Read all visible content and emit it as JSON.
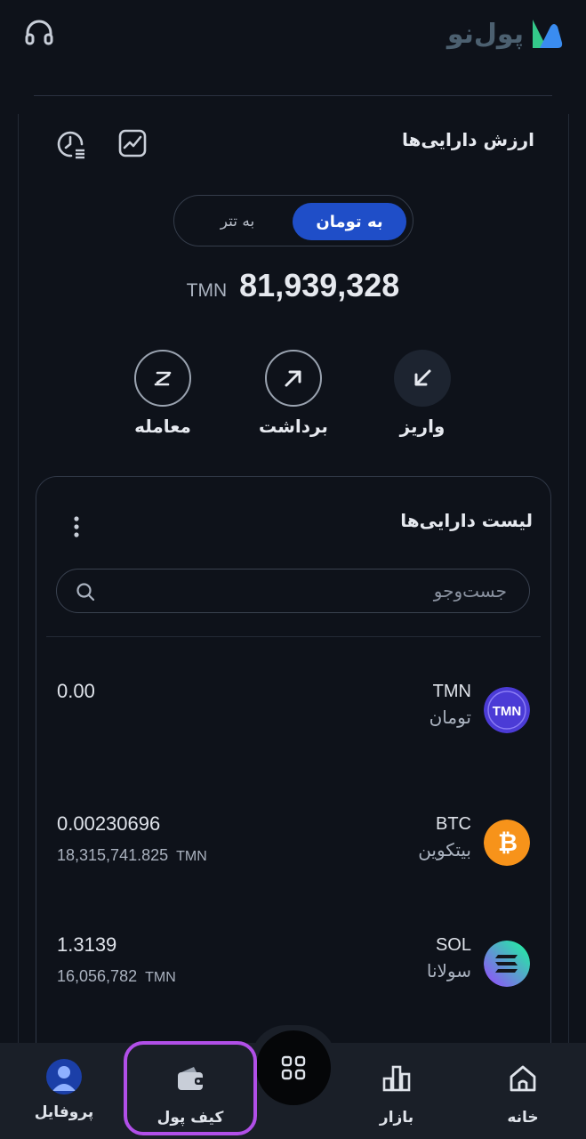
{
  "header": {
    "logo_text": "پول‌نو"
  },
  "overview": {
    "title": "ارزش دارایی‌ها",
    "toggle_toman": "به تومان",
    "toggle_tether": "به تتر",
    "balance_value": "81,939,328",
    "balance_unit": "TMN"
  },
  "actions": {
    "deposit": "واریز",
    "withdraw": "برداشت",
    "trade": "معامله"
  },
  "assets": {
    "title": "لیست دارایی‌ها",
    "search_placeholder": "جست‌وجو",
    "items": [
      {
        "symbol": "TMN",
        "name": "تومان",
        "amount": "0.00",
        "value": "",
        "unit": ""
      },
      {
        "symbol": "BTC",
        "name": "بیتکوین",
        "amount": "0.00230696",
        "value": "18,315,741.825",
        "unit": "TMN"
      },
      {
        "symbol": "SOL",
        "name": "سولانا",
        "amount": "1.3139",
        "value": "16,056,782",
        "unit": "TMN"
      }
    ]
  },
  "nav": {
    "home": "خانه",
    "market": "بازار",
    "wallet": "کیف پول",
    "profile": "پروفایل"
  },
  "colors": {
    "background": "#0e121a",
    "accent": "#1f4ec8",
    "highlight": "#b14fe8",
    "btc": "#f7931a",
    "tmn": "#4b3bd6"
  }
}
